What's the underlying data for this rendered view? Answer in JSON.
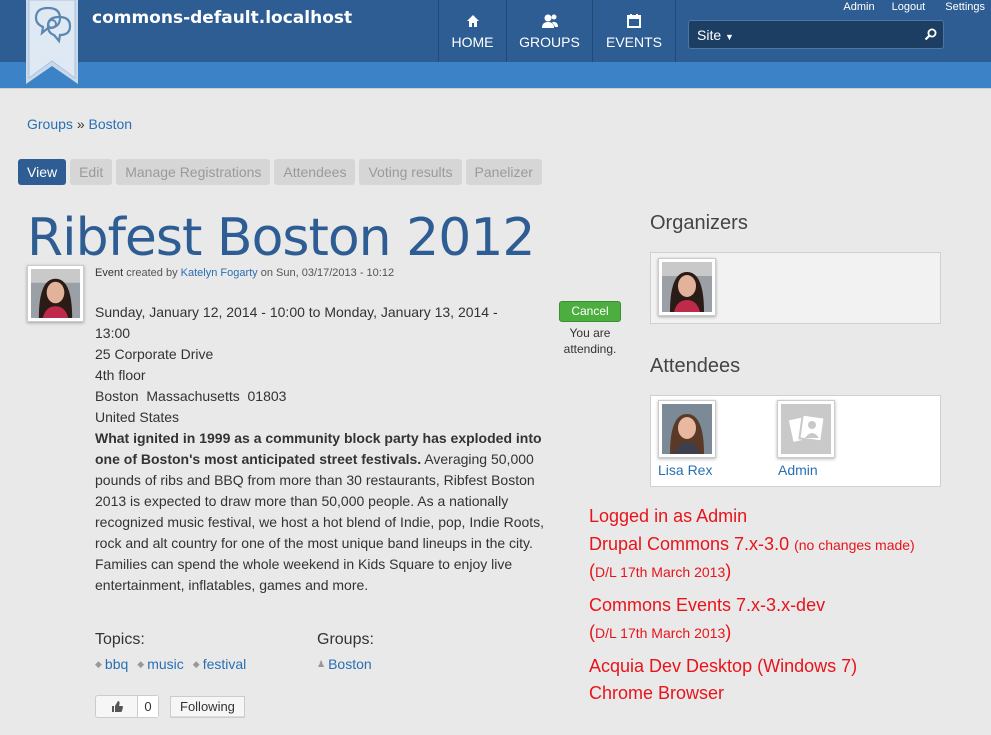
{
  "header": {
    "site_name": "commons-default.localhost",
    "nav": [
      {
        "label": "HOME",
        "icon": "home-icon"
      },
      {
        "label": "GROUPS",
        "icon": "groups-icon"
      },
      {
        "label": "EVENTS",
        "icon": "calendar-icon"
      }
    ],
    "user_links": [
      "Admin",
      "Logout",
      "Settings"
    ],
    "search": {
      "scope_label": "Site",
      "placeholder": ""
    },
    "colors": {
      "bar": "#2d5d93",
      "subbar": "#3b83c6"
    }
  },
  "breadcrumb": {
    "first": "Groups",
    "separator": "»",
    "second": "Boston"
  },
  "tabs": [
    "View",
    "Edit",
    "Manage Registrations",
    "Attendees",
    "Voting results",
    "Panelizer"
  ],
  "event": {
    "title": "Ribfest Boston 2012",
    "meta_type": "Event",
    "meta_created_by": "created by",
    "meta_author": "Katelyn Fogarty",
    "meta_on": "on Sun, 03/17/2013 - 10:12",
    "date_line1": "Sunday, January 12, 2014 - 10:00 to Monday, January 13, 2014 -",
    "date_line2": "13:00",
    "address": [
      "25 Corporate Drive",
      "4th floor",
      "Boston  Massachusetts  01803",
      "United States"
    ],
    "body_bold": "What ignited in 1999 as a community block party has exploded into one of Boston's most anticipated street festivals.",
    "body_rest": " Averaging 50,000 pounds of ribs and BBQ from more than 30 restaurants, Ribfest Boston 2013 is expected to draw more than 50,000 people. As a nationally recognized music festival, we host a hot blend of Indie, pop, Indie Roots, rock and alt country for one of the most unique band lineups in the city. Families can spend the whole weekend in Kids Square to enjoy live entertainment, inflatables, games and more.",
    "cancel_label": "Cancel",
    "attending_text": "You are attending.",
    "topics_label": "Topics:",
    "topics": [
      "bbq",
      "music",
      "festival"
    ],
    "groups_label": "Groups:",
    "groups": [
      "Boston"
    ],
    "like_count": "0",
    "following_label": "Following"
  },
  "sidebar": {
    "organizers_heading": "Organizers",
    "attendees_heading": "Attendees",
    "attendees": [
      "Lisa Rex",
      "Admin"
    ]
  },
  "notes": {
    "line1": "Logged in as Admin",
    "line2_main": "Drupal Commons 7.x-3.0",
    "line2_small": "(no changes made)",
    "line3_open": "(",
    "line3_small": "D/L 17th March 2013",
    "line3_close": ")",
    "line4": "Commons Events 7.x-3.x-dev",
    "line5_open": "(",
    "line5_small": "D/L 17th March 2013",
    "line5_close": ")",
    "line6": "Acquia Dev Desktop (Windows 7)",
    "line7": "Chrome Browser",
    "color": "#e8141a"
  }
}
